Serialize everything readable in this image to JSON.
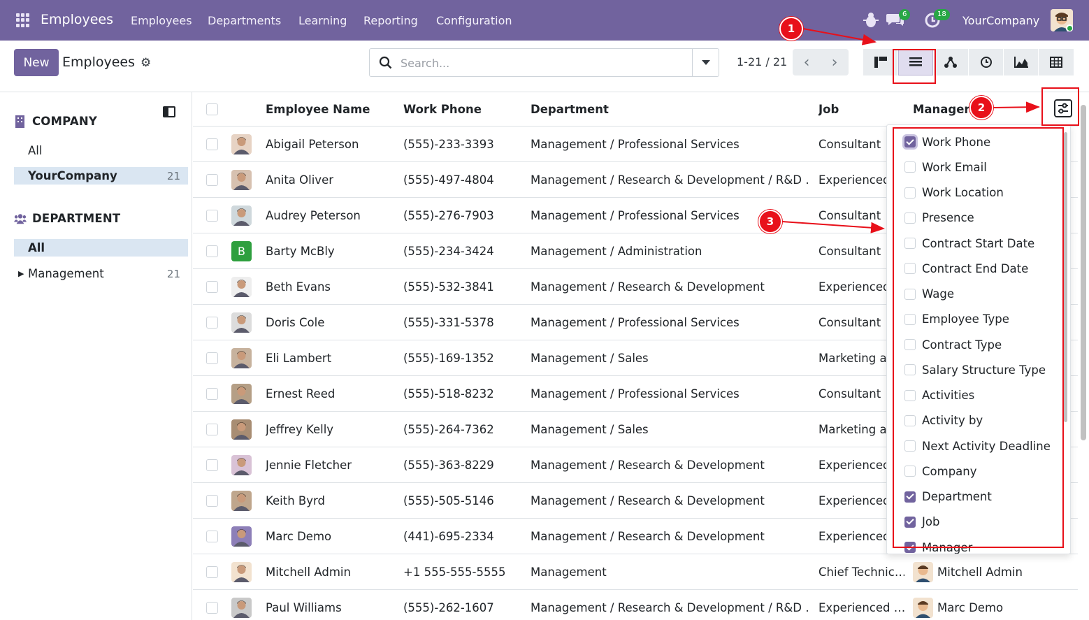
{
  "navbar": {
    "brand": "Employees",
    "menu": [
      "Employees",
      "Departments",
      "Learning",
      "Reporting",
      "Configuration"
    ],
    "chat_count": "6",
    "activity_count": "18",
    "company": "YourCompany",
    "icons": [
      "apps-grid-icon",
      "debug-bug-icon",
      "chat-icon",
      "activity-clock-icon"
    ]
  },
  "control": {
    "new_label": "New",
    "title": "Employees",
    "search_placeholder": "Search...",
    "pager": "1-21 / 21",
    "views": [
      "kanban-view",
      "list-view",
      "hierarchy-view",
      "activity-view",
      "graph-view",
      "pivot-view"
    ],
    "active_view": "list-view"
  },
  "sidebar": {
    "company_header": "COMPANY",
    "company_items": [
      {
        "label": "All",
        "count": ""
      },
      {
        "label": "YourCompany",
        "count": "21"
      }
    ],
    "department_header": "DEPARTMENT",
    "department_items": [
      {
        "label": "All",
        "count": ""
      },
      {
        "label": "Management",
        "count": "21"
      }
    ]
  },
  "table": {
    "headers": [
      "Employee Name",
      "Work Phone",
      "Department",
      "Job",
      "Manager"
    ],
    "rows": [
      {
        "name": "Abigail Peterson",
        "phone": "(555)-233-3393",
        "dept": "Management / Professional Services",
        "job": "Consultant",
        "manager": ""
      },
      {
        "name": "Anita Oliver",
        "phone": "(555)-497-4804",
        "dept": "Management / Research & Development / R&D …",
        "job": "Experienced",
        "manager": ""
      },
      {
        "name": "Audrey Peterson",
        "phone": "(555)-276-7903",
        "dept": "Management / Professional Services",
        "job": "Consultant",
        "manager": ""
      },
      {
        "name": "Barty McBly",
        "phone": "(555)-234-3424",
        "dept": "Management / Administration",
        "job": "Consultant",
        "manager": "",
        "letter": "B"
      },
      {
        "name": "Beth Evans",
        "phone": "(555)-532-3841",
        "dept": "Management / Research & Development",
        "job": "Experienced",
        "manager": ""
      },
      {
        "name": "Doris Cole",
        "phone": "(555)-331-5378",
        "dept": "Management / Professional Services",
        "job": "Consultant",
        "manager": ""
      },
      {
        "name": "Eli Lambert",
        "phone": "(555)-169-1352",
        "dept": "Management / Sales",
        "job": "Marketing ar",
        "manager": ""
      },
      {
        "name": "Ernest Reed",
        "phone": "(555)-518-8232",
        "dept": "Management / Professional Services",
        "job": "Consultant",
        "manager": ""
      },
      {
        "name": "Jeffrey Kelly",
        "phone": "(555)-264-7362",
        "dept": "Management / Sales",
        "job": "Marketing ar",
        "manager": ""
      },
      {
        "name": "Jennie Fletcher",
        "phone": "(555)-363-8229",
        "dept": "Management / Research & Development",
        "job": "Experienced",
        "manager": ""
      },
      {
        "name": "Keith Byrd",
        "phone": "(555)-505-5146",
        "dept": "Management / Research & Development",
        "job": "Experienced",
        "manager": ""
      },
      {
        "name": "Marc Demo",
        "phone": "(441)-695-2334",
        "dept": "Management / Research & Development",
        "job": "Experienced",
        "manager": ""
      },
      {
        "name": "Mitchell Admin",
        "phone": "+1 555-555-5555",
        "dept": "Management",
        "job": "Chief Technic…",
        "manager": "Mitchell Admin"
      },
      {
        "name": "Paul Williams",
        "phone": "(555)-262-1607",
        "dept": "Management / Research & Development / R&D …",
        "job": "Experienced …",
        "manager": "Marc Demo"
      }
    ]
  },
  "optional_columns": [
    {
      "label": "Work Phone",
      "checked": true
    },
    {
      "label": "Work Email",
      "checked": false
    },
    {
      "label": "Work Location",
      "checked": false
    },
    {
      "label": "Presence",
      "checked": false
    },
    {
      "label": "Contract Start Date",
      "checked": false
    },
    {
      "label": "Contract End Date",
      "checked": false
    },
    {
      "label": "Wage",
      "checked": false
    },
    {
      "label": "Employee Type",
      "checked": false
    },
    {
      "label": "Contract Type",
      "checked": false
    },
    {
      "label": "Salary Structure Type",
      "checked": false
    },
    {
      "label": "Activities",
      "checked": false
    },
    {
      "label": "Activity by",
      "checked": false
    },
    {
      "label": "Next Activity Deadline",
      "checked": false
    },
    {
      "label": "Company",
      "checked": false
    },
    {
      "label": "Department",
      "checked": true
    },
    {
      "label": "Job",
      "checked": true
    },
    {
      "label": "Manager",
      "checked": true
    }
  ],
  "annotations": [
    "1",
    "2",
    "3"
  ],
  "colors": {
    "brand": "#71639e",
    "annotation": "#e8101a",
    "selected_bg": "#dae6f2",
    "badge": "#28a745"
  }
}
